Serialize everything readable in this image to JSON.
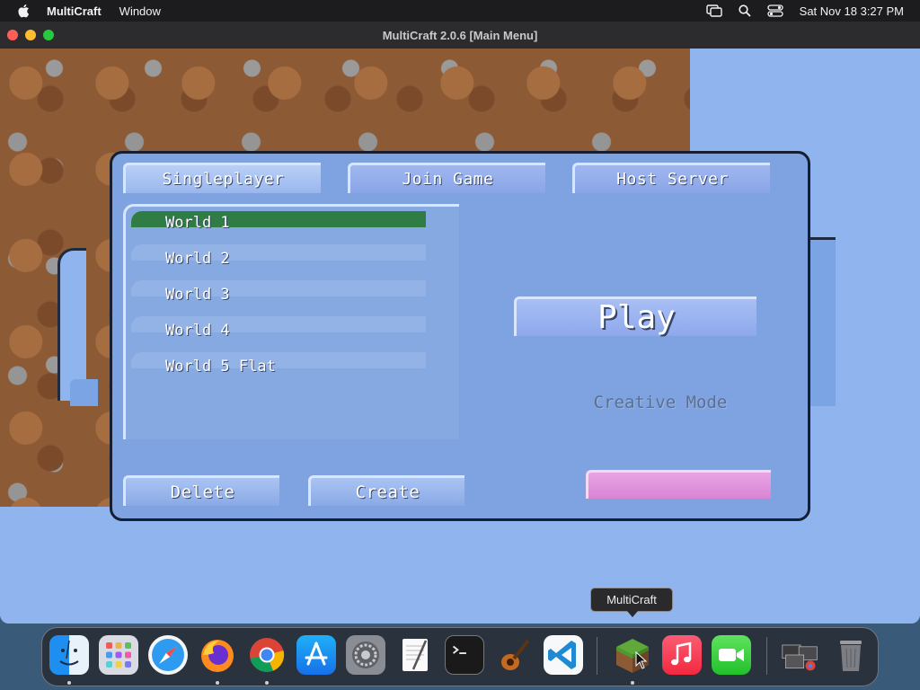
{
  "menubar": {
    "app_name": "MultiCraft",
    "menus": [
      "Window"
    ],
    "datetime": "Sat Nov 18  3:27 PM"
  },
  "window": {
    "title": "MultiCraft 2.0.6 [Main Menu]"
  },
  "main_menu": {
    "tabs": [
      {
        "label": "Singleplayer",
        "selected": true
      },
      {
        "label": "Join Game",
        "selected": false
      },
      {
        "label": "Host Server",
        "selected": false
      }
    ],
    "worlds": [
      {
        "label": "World 1",
        "selected": true
      },
      {
        "label": "World 2",
        "selected": false
      },
      {
        "label": "World 3",
        "selected": false
      },
      {
        "label": "World 4",
        "selected": false
      },
      {
        "label": "World 5 Flat",
        "selected": false
      }
    ],
    "play_label": "Play",
    "mode_label": "Creative Mode",
    "delete_label": "Delete",
    "create_label": "Create"
  },
  "dock": {
    "tooltip": "MultiCraft",
    "apps": [
      {
        "name": "Finder",
        "icon": "finder-icon",
        "running": true
      },
      {
        "name": "Launchpad",
        "icon": "launchpad-icon",
        "running": false
      },
      {
        "name": "Safari",
        "icon": "safari-icon",
        "running": false
      },
      {
        "name": "Firefox",
        "icon": "firefox-icon",
        "running": true
      },
      {
        "name": "Google Chrome",
        "icon": "chrome-icon",
        "running": true
      },
      {
        "name": "App Store",
        "icon": "app-store-icon",
        "running": false
      },
      {
        "name": "System Settings",
        "icon": "system-settings-icon",
        "running": false
      },
      {
        "name": "TextEdit",
        "icon": "textedit-icon",
        "running": false
      },
      {
        "name": "Terminal",
        "icon": "terminal-icon",
        "running": false
      },
      {
        "name": "GarageBand",
        "icon": "garageband-icon",
        "running": false
      },
      {
        "name": "Visual Studio Code",
        "icon": "vscode-icon",
        "running": false
      },
      {
        "name": "MultiCraft",
        "icon": "multicraft-icon",
        "running": true
      },
      {
        "name": "Music",
        "icon": "music-icon",
        "running": false
      },
      {
        "name": "FaceTime",
        "icon": "facetime-icon",
        "running": false
      },
      {
        "name": "Downloads",
        "icon": "downloads-stack-icon",
        "running": false
      },
      {
        "name": "Trash",
        "icon": "trash-icon",
        "running": false
      }
    ]
  },
  "colors": {
    "sky": "#8fb4ee",
    "panel": "#7ea3e0",
    "selected_world": "#2f7d44",
    "pink_button": "#e09ad9"
  }
}
